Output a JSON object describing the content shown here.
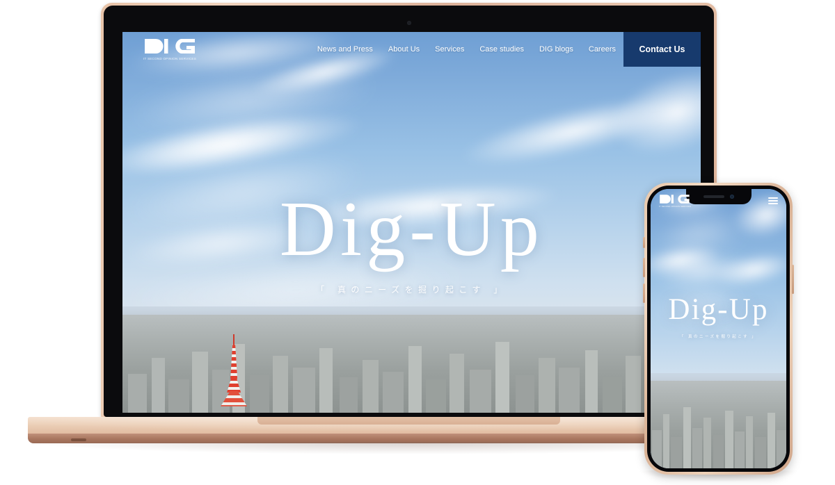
{
  "brand": {
    "logo_mark": "DIG",
    "logo_sub": "IT SECOND OPINION SERVICES",
    "accent_navy": "#173a6d",
    "frame_rose_gold": "#e8c6ae"
  },
  "nav": {
    "items": [
      {
        "label": "News and Press"
      },
      {
        "label": "About Us"
      },
      {
        "label": "Services"
      },
      {
        "label": "Case studies"
      },
      {
        "label": "DIG blogs"
      },
      {
        "label": "Careers"
      }
    ],
    "contact_label": "Contact Us",
    "mobile_menu_icon": "hamburger-icon"
  },
  "hero": {
    "title": "Dig-Up",
    "subtitle": "「 真のニーズを掘り起こす 」",
    "background_description": "Tokyo skyline with Tokyo Tower under a blue sky with wispy clouds"
  },
  "devices": {
    "laptop": {
      "label": "laptop-mockup",
      "camera": "webcam-dot"
    },
    "phone": {
      "label": "phone-mockup",
      "notch": "notch-camera-speaker"
    }
  }
}
